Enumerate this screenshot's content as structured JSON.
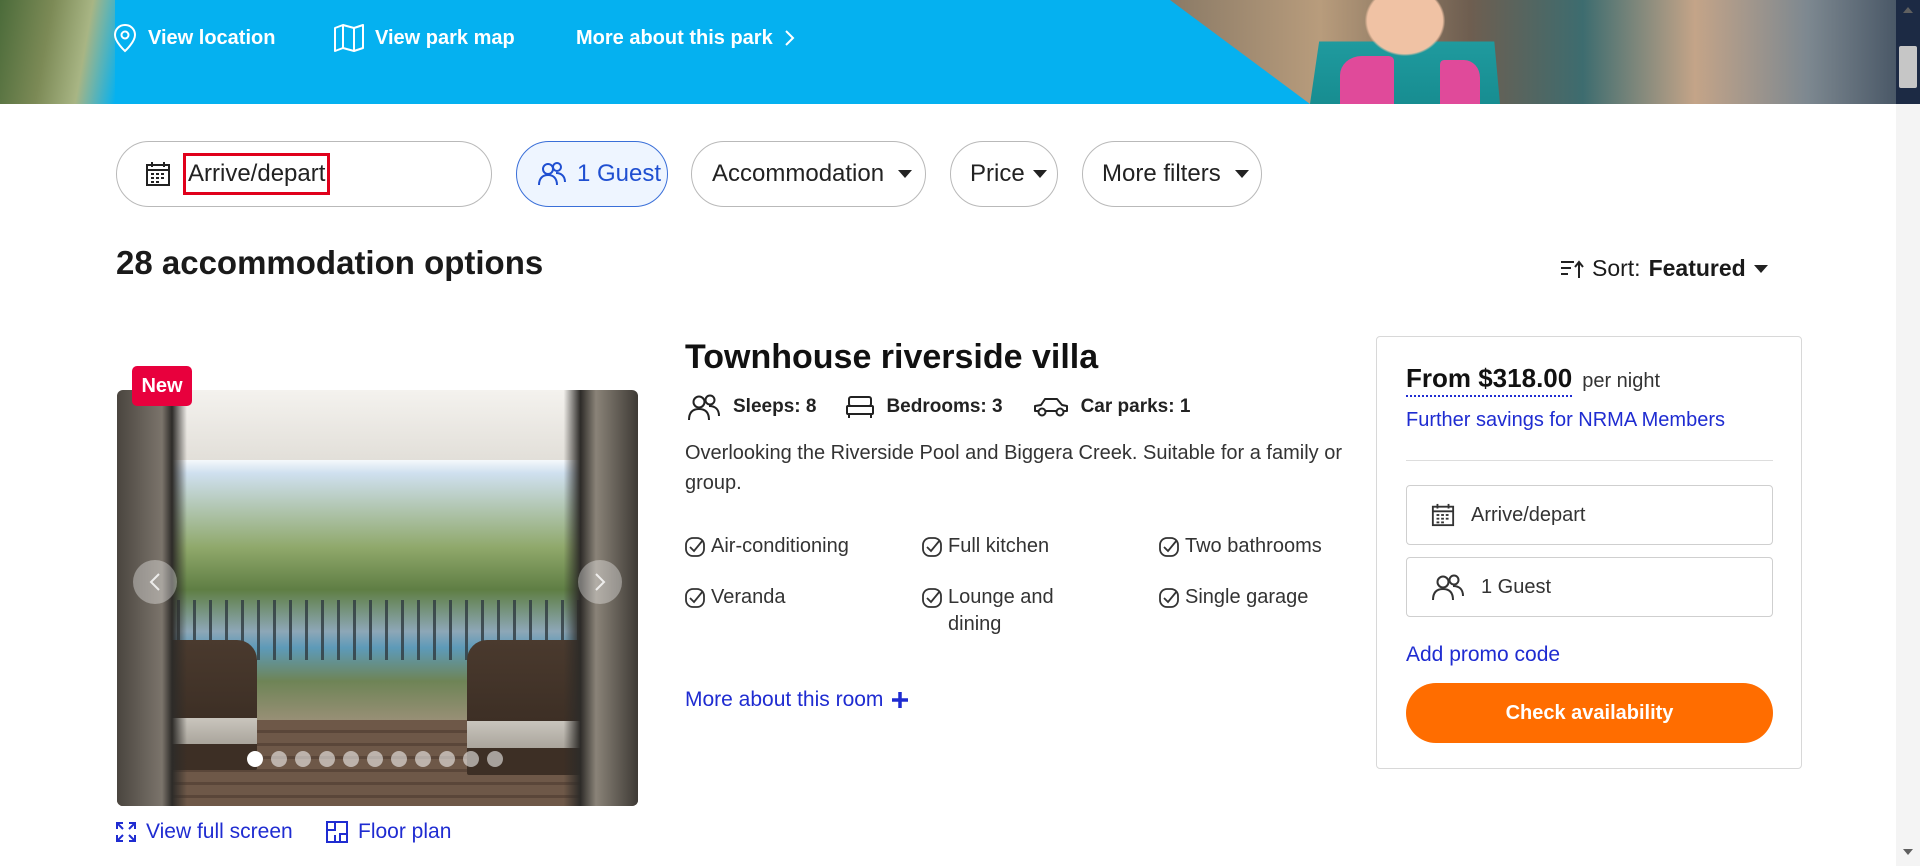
{
  "hero": {
    "nav": [
      {
        "label": "View location",
        "icon": "map-pin-icon"
      },
      {
        "label": "View park map",
        "icon": "map-icon"
      },
      {
        "label": "More about this park",
        "icon": "chevron-right-icon"
      }
    ]
  },
  "filters": {
    "date_label": "Arrive/depart",
    "guests_label": "1 Guest",
    "accommodation_label": "Accommodation",
    "price_label": "Price",
    "more_filters_label": "More filters"
  },
  "results": {
    "title": "28 accommodation options",
    "sort_prefix": "Sort:",
    "sort_value": "Featured"
  },
  "card": {
    "badge": "New",
    "title": "Townhouse riverside villa",
    "stats": {
      "sleeps": "Sleeps: 8",
      "bedrooms": "Bedrooms: 3",
      "car_parks": "Car parks: 1"
    },
    "description": "Overlooking the Riverside Pool and Biggera Creek. Suitable for a family or group.",
    "features": [
      "Air-conditioning",
      "Full kitchen",
      "Two bathrooms",
      "Veranda",
      "Lounge and dining",
      "Single garage"
    ],
    "more_link": "More about this room",
    "view_full_screen": "View full screen",
    "floor_plan": "Floor plan",
    "carousel": {
      "total": 11,
      "current": 1
    }
  },
  "booking": {
    "price": "From $318.00",
    "per_night": "per night",
    "savings_link": "Further savings for NRMA Members",
    "date_field": "Arrive/depart",
    "guest_field": "1 Guest",
    "promo_link": "Add promo code",
    "cta": "Check availability"
  },
  "colors": {
    "hero_blue": "#05b1f0",
    "link_blue": "#1f2cd1",
    "cta_orange": "#ff6d00",
    "badge_red": "#e8003d",
    "highlight_red": "#e0001b"
  }
}
